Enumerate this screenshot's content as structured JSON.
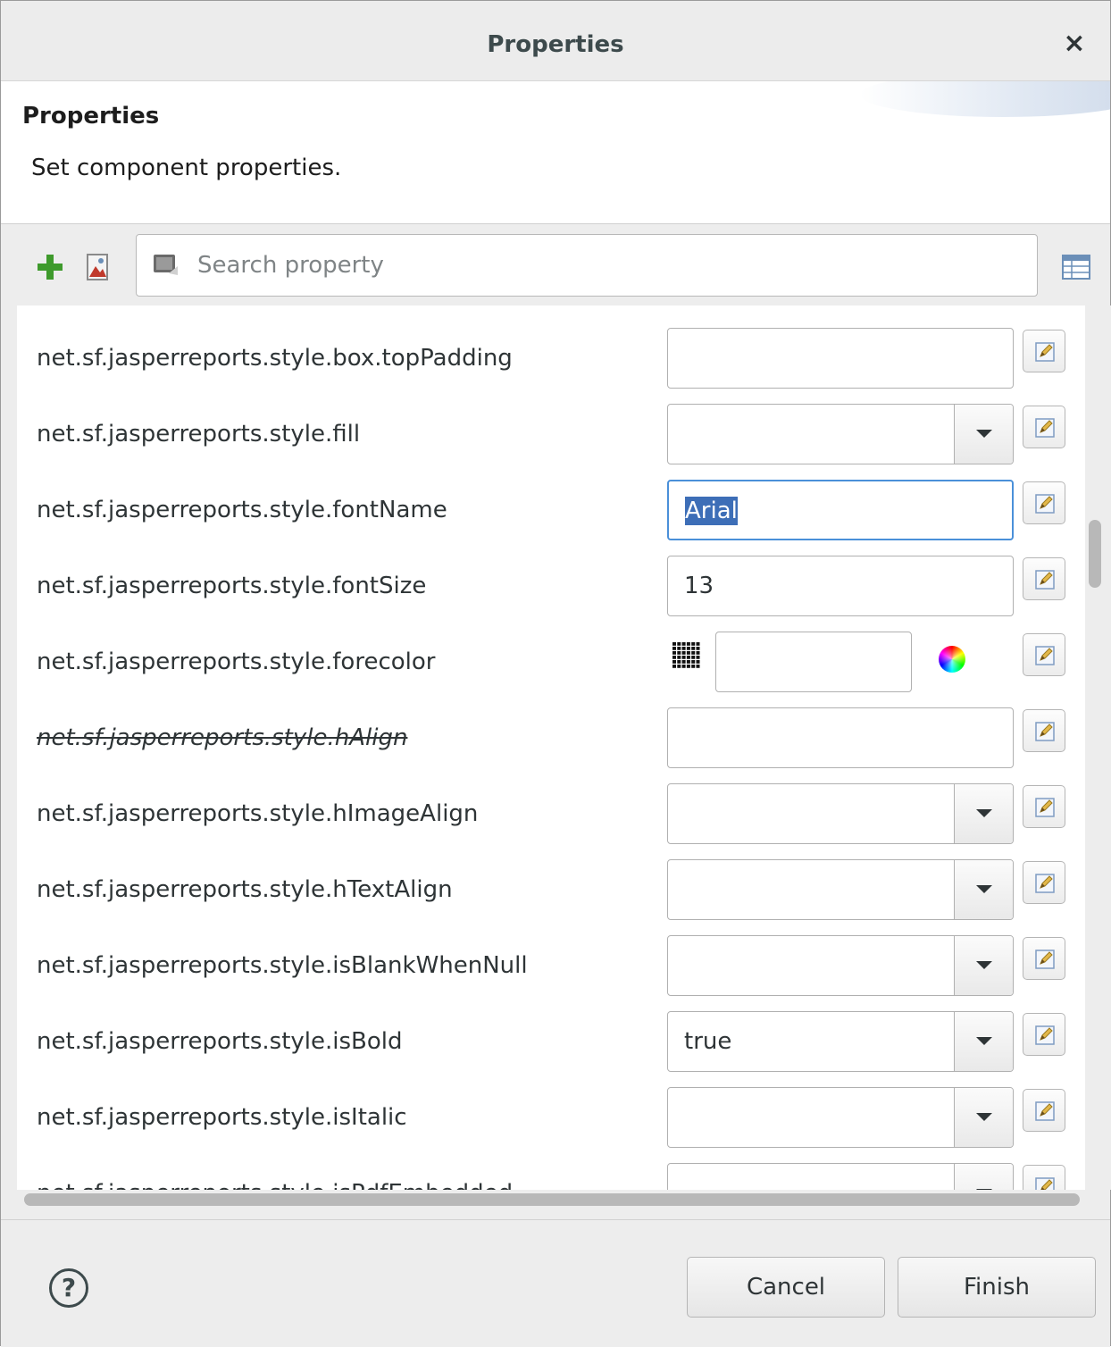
{
  "window": {
    "title": "Properties",
    "close_glyph": "×"
  },
  "header": {
    "title": "Properties",
    "description": "Set component properties."
  },
  "toolbar": {
    "add_icon": "plus-icon",
    "remove_icon": "image-icon",
    "search": {
      "placeholder": "Search property",
      "value": ""
    },
    "view_icon": "table-view-icon"
  },
  "properties": [
    {
      "name": "net.sf.jasperreports.style.box.topPadding",
      "kind": "text",
      "value": ""
    },
    {
      "name": "net.sf.jasperreports.style.fill",
      "kind": "combo",
      "value": ""
    },
    {
      "name": "net.sf.jasperreports.style.fontName",
      "kind": "text",
      "value": "Arial",
      "focused": true
    },
    {
      "name": "net.sf.jasperreports.style.fontSize",
      "kind": "text",
      "value": "13"
    },
    {
      "name": "net.sf.jasperreports.style.forecolor",
      "kind": "color",
      "value": ""
    },
    {
      "name": "net.sf.jasperreports.style.hAlign",
      "kind": "text",
      "value": "",
      "deprecated": true
    },
    {
      "name": "net.sf.jasperreports.style.hImageAlign",
      "kind": "combo",
      "value": ""
    },
    {
      "name": "net.sf.jasperreports.style.hTextAlign",
      "kind": "combo",
      "value": ""
    },
    {
      "name": "net.sf.jasperreports.style.isBlankWhenNull",
      "kind": "combo",
      "value": ""
    },
    {
      "name": "net.sf.jasperreports.style.isBold",
      "kind": "combo",
      "value": "true"
    },
    {
      "name": "net.sf.jasperreports.style.isItalic",
      "kind": "combo",
      "value": ""
    },
    {
      "name": "net.sf.jasperreports.style.isPdfEmbedded",
      "kind": "combo",
      "value": ""
    }
  ],
  "footer": {
    "help_glyph": "?",
    "cancel_label": "Cancel",
    "finish_label": "Finish"
  },
  "colors": {
    "selection": "#3d6eb7",
    "focus_border": "#4a90d9",
    "add_icon_green": "#3e9a2c"
  }
}
